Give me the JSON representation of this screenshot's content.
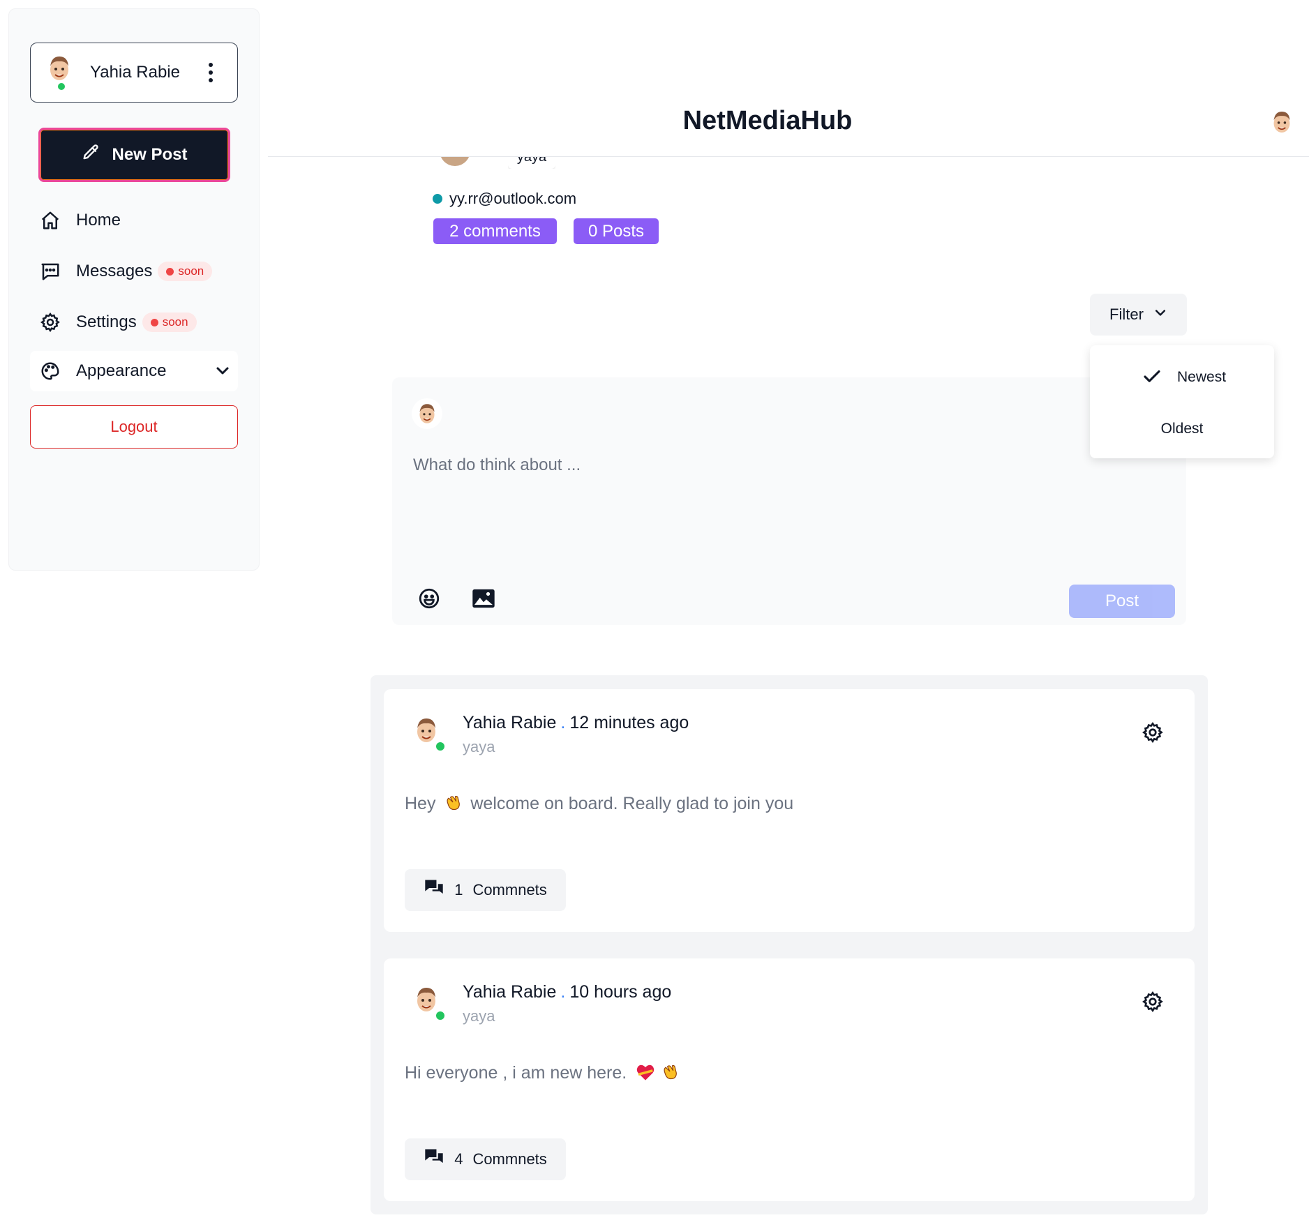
{
  "sidebar": {
    "user_name": "Yahia Rabie",
    "new_post_label": "New Post",
    "nav": {
      "home": "Home",
      "messages": "Messages",
      "settings": "Settings",
      "soon": "soon",
      "appearance": "Appearance"
    },
    "logout_label": "Logout"
  },
  "header": {
    "brand": "NetMediaHub"
  },
  "profile": {
    "username_partial": "yaya",
    "email": "yy.rr@outlook.com",
    "comments_count": "2 comments",
    "posts_count": "0 Posts"
  },
  "filter": {
    "label": "Filter",
    "options": [
      "Newest",
      "Oldest"
    ],
    "selected": "Newest"
  },
  "composer": {
    "placeholder": "What do think about ...",
    "post_label": "Post"
  },
  "posts": [
    {
      "author": "Yahia Rabie",
      "time": "12 minutes ago",
      "username": "yaya",
      "text_before": "Hey",
      "text_after": "welcome on board. Really glad to join you",
      "comments_count": "1",
      "comments_label": "Commnets"
    },
    {
      "author": "Yahia Rabie",
      "time": "10 hours ago",
      "username": "yaya",
      "text": "Hi everyone , i am new here.",
      "comments_count": "4",
      "comments_label": "Commnets"
    }
  ],
  "colors": {
    "accent_purple": "#8b5cf6",
    "online": "#22c55e",
    "danger": "#dc2626",
    "dark": "#111827",
    "post_button": "#a5b4fc"
  },
  "icons": [
    "pencil-icon",
    "home-icon",
    "chat-icon",
    "gear-icon",
    "palette-icon",
    "chevron-down-icon",
    "kebab-icon",
    "smile-icon",
    "image-icon",
    "comments-icon",
    "check-icon",
    "wave-emoji",
    "heart-emoji"
  ]
}
